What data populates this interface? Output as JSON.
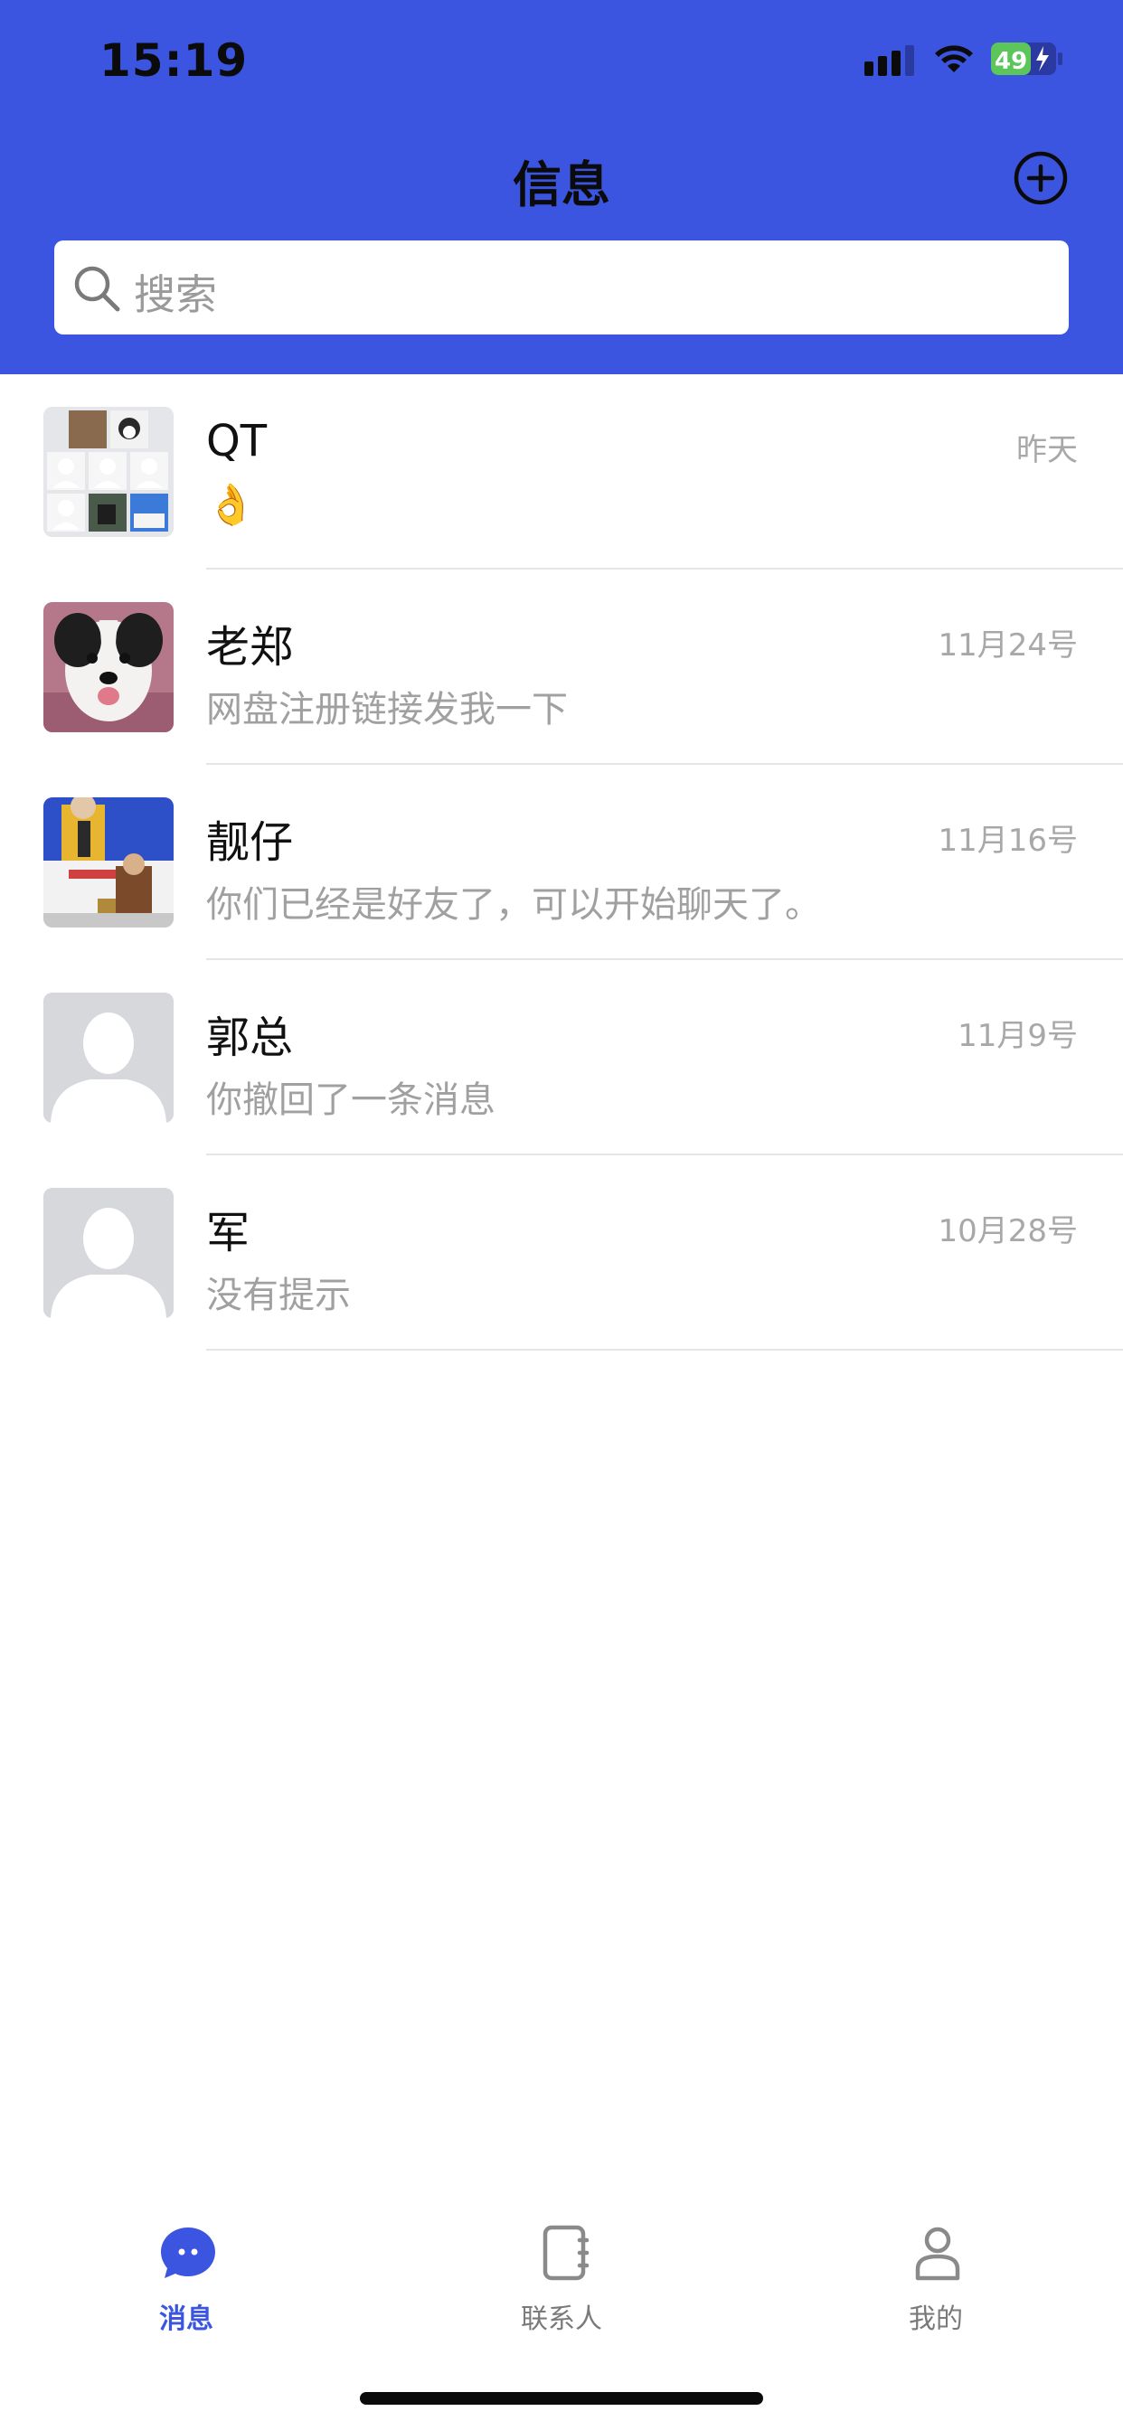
{
  "status_bar": {
    "time": "15:19",
    "battery": "49"
  },
  "header": {
    "title": "信息"
  },
  "search": {
    "placeholder": "搜索"
  },
  "conversations": [
    {
      "name": "QT",
      "date": "昨天",
      "preview": "👌",
      "avatar": "group-avatar"
    },
    {
      "name": "老郑",
      "date": "11月24号",
      "preview": "网盘注册链接发我一下",
      "avatar": "dog-photo-avatar"
    },
    {
      "name": "靓仔",
      "date": "11月16号",
      "preview": "你们已经是好友了，可以开始聊天了。",
      "avatar": "photo-avatar"
    },
    {
      "name": "郭总",
      "date": "11月9号",
      "preview": "你撤回了一条消息",
      "avatar": "default-avatar"
    },
    {
      "name": "军",
      "date": "10月28号",
      "preview": "没有提示",
      "avatar": "default-avatar"
    }
  ],
  "tabs": [
    {
      "label": "消息",
      "icon": "chat-bubble-icon",
      "active": true
    },
    {
      "label": "联系人",
      "icon": "contacts-book-icon",
      "active": false
    },
    {
      "label": "我的",
      "icon": "person-icon",
      "active": false
    }
  ],
  "colors": {
    "brand_blue": "#3b55e0",
    "muted_text": "#a0a0a0",
    "divider": "#e6e6e6"
  }
}
